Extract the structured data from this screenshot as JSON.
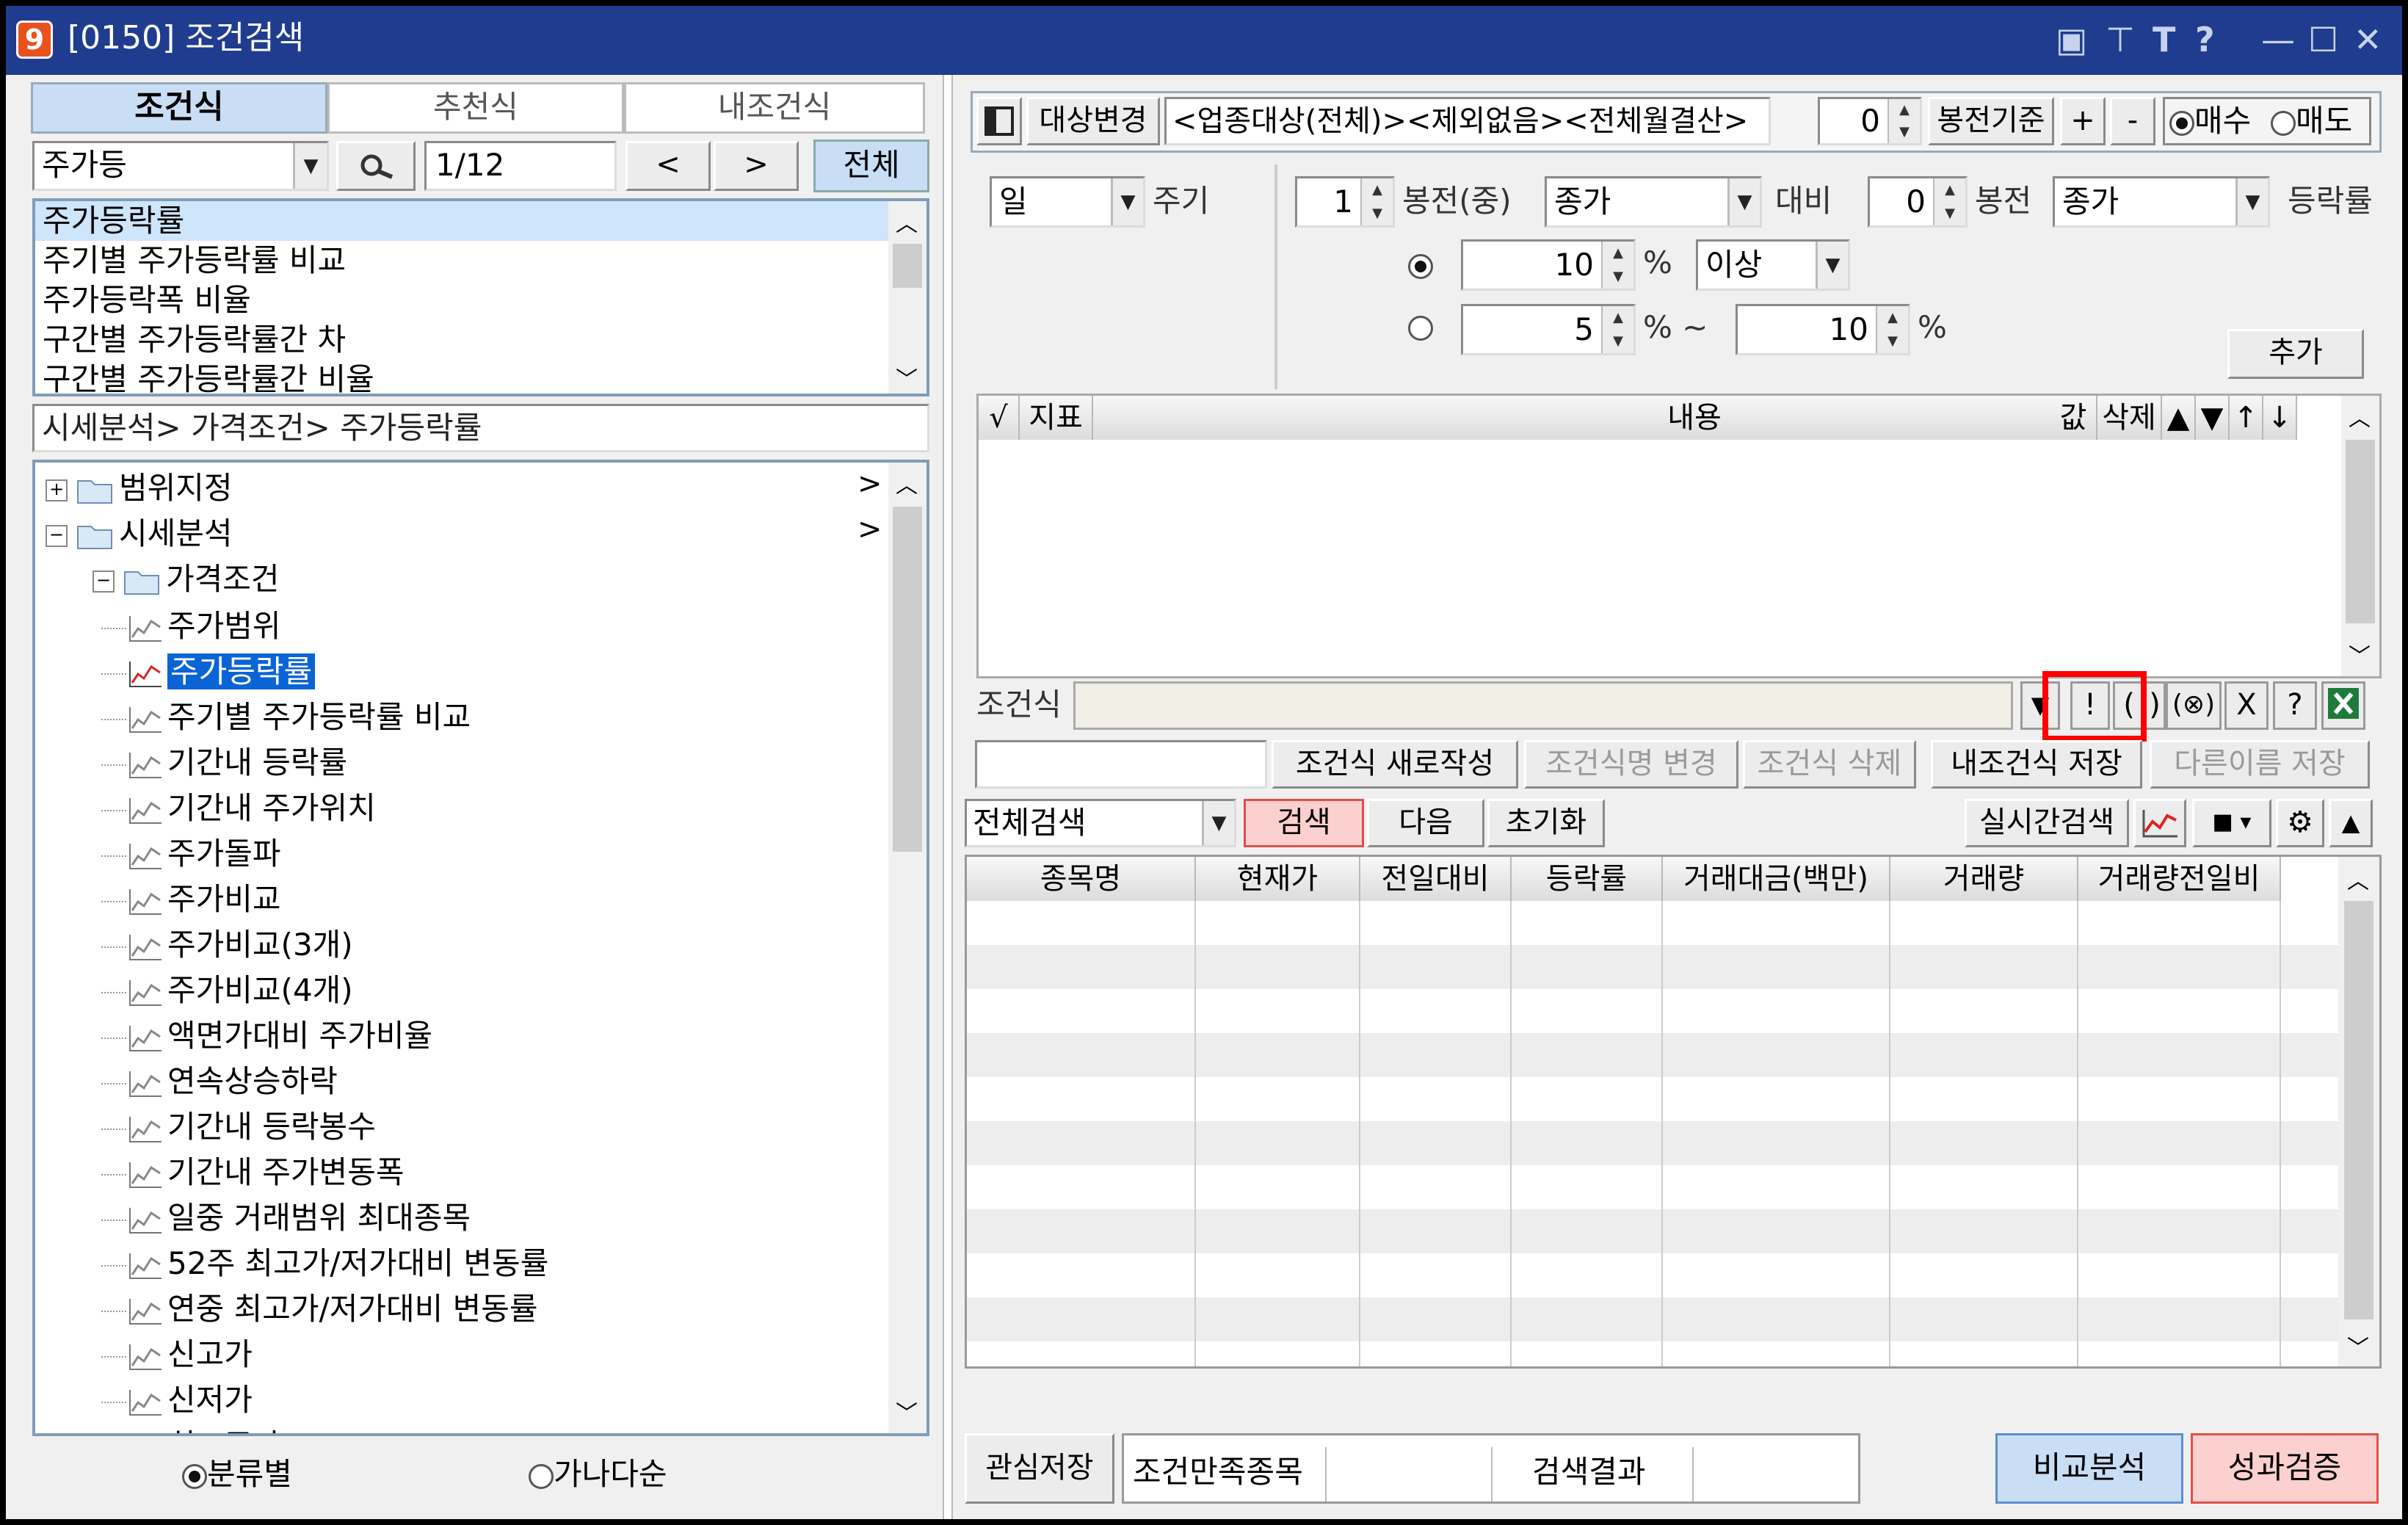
{
  "window": {
    "title": "[0150] 조건검색",
    "app_badge": "9"
  },
  "left": {
    "tabs": [
      "조건식",
      "추천식",
      "내조건식"
    ],
    "search": {
      "value": "주가등",
      "page": "1/12",
      "prev": "<",
      "next": ">",
      "all": "전체"
    },
    "results": [
      "주가등락률",
      "주기별 주가등락률 비교",
      "주가등락폭 비율",
      "구간별 주가등락률간 차",
      "구간별 주가등락률간 비율"
    ],
    "path": "시세분석> 가격조건> 주가등락률",
    "tree": {
      "root1": "범위지정",
      "root2": "시세분석",
      "sub": "가격조건",
      "items": [
        "주가범위",
        "주가등락률",
        "주기별 주가등락률 비교",
        "기간내 등락률",
        "기간내 주가위치",
        "주가돌파",
        "주가비교",
        "주가비교(3개)",
        "주가비교(4개)",
        "액면가대비 주가비율",
        "연속상승하락",
        "기간내 등락봉수",
        "기간내 주가변동폭",
        "일중 거래범위 최대종목",
        "52주 최고가/저가대비 변동률",
        "연중 최고가/저가대비 변동률",
        "신고가",
        "신저가",
        "최고주가"
      ]
    },
    "sort": {
      "by_category": "분류별",
      "by_name": "가나다순"
    }
  },
  "right": {
    "target_btn": "대상변경",
    "target_text": "<업종대상(전체)><제외없음><전체월결산>",
    "bar_num": "0",
    "bar_basis": "봉전기준",
    "plus": "+",
    "minus": "-",
    "buy": "매수",
    "sell": "매도",
    "cond": {
      "period": "일",
      "period_label": "주기",
      "n1": "1",
      "bar_mid": "봉전(중)",
      "price1": "종가",
      "vs": "대비",
      "n2": "0",
      "bar": "봉전",
      "price2": "종가",
      "rate": "등락률",
      "v1": "10",
      "pct": "%",
      "above": "이상",
      "v2": "5",
      "tilde": "% ~",
      "v3": "10",
      "add": "추가"
    },
    "grid_headers": [
      "√",
      "지표",
      "내용",
      "값",
      "삭제",
      "▲",
      "▼",
      "↑",
      "↓"
    ],
    "expr_label": "조건식",
    "expr_btns": [
      "▼",
      "!",
      "(",
      ")",
      "(⊗)",
      "X",
      "?"
    ],
    "actions": [
      "조건식 새로작성",
      "조건식명 변경",
      "조건식 삭제",
      "내조건식 저장",
      "다른이름 저장"
    ],
    "search_mode": "전체검색",
    "search_btn": "검색",
    "next_btn": "다음",
    "reset_btn": "초기화",
    "realtime_btn": "실시간검색",
    "result_headers": [
      "종목명",
      "현재가",
      "전일대비",
      "등락률",
      "거래대금(백만)",
      "거래량",
      "거래량전일비"
    ],
    "bottom": {
      "save_watch": "관심저장",
      "matched": "조건만족종목",
      "result_label": "검색결과",
      "compare": "비교분석",
      "verify": "성과검증"
    }
  },
  "colors": {
    "title_bg": "#1f3c8f",
    "tab_active": "#c9def5",
    "highlight": "#ff0000",
    "selected_item": "#0a64d6"
  }
}
